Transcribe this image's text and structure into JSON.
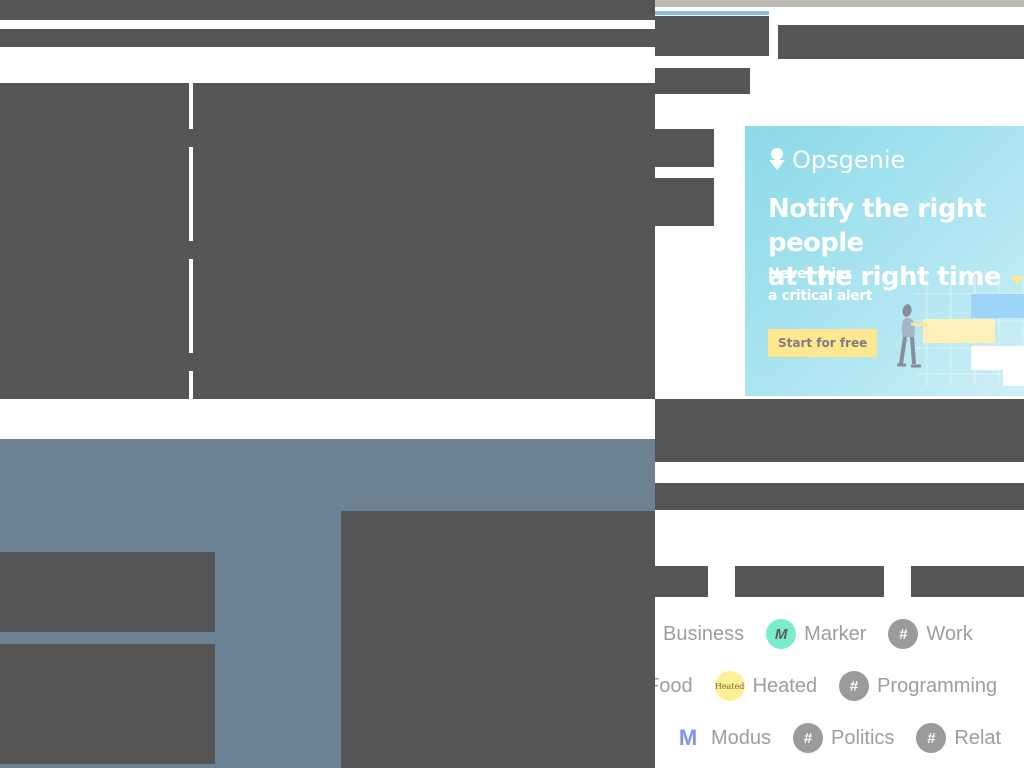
{
  "ad": {
    "brand": "Opsgenie",
    "headline": "Notify the right people\nat the right time",
    "subline": "Never miss\na critical alert",
    "cta": "Start for free"
  },
  "topics": {
    "row1": [
      {
        "label": "Business",
        "icon": "hash-icon"
      },
      {
        "label": "Marker",
        "icon": "marker-icon",
        "glyph": "M"
      },
      {
        "label": "Work",
        "icon": "hash-icon"
      }
    ],
    "row2": [
      {
        "label": "Food",
        "icon": "hash-icon"
      },
      {
        "label": "Heated",
        "icon": "heated-icon",
        "glyph": "Heated"
      },
      {
        "label": "Programming",
        "icon": "hash-icon"
      }
    ],
    "row3": [
      {
        "label": "Modus",
        "icon": "modus-icon",
        "glyph": "M"
      },
      {
        "label": "Politics",
        "icon": "hash-icon"
      },
      {
        "label": "Relat",
        "icon": "hash-icon"
      }
    ]
  },
  "icons": {
    "hash": "#"
  },
  "colors": {
    "redaction": "#555555",
    "hero_background": "#6b8194",
    "ad_background": "#3fc1d8",
    "cta_background": "#ffd84a",
    "marker_icon": "#5be9c3",
    "heated_icon": "#ffef8a",
    "modus_icon": "#4b66e0"
  }
}
